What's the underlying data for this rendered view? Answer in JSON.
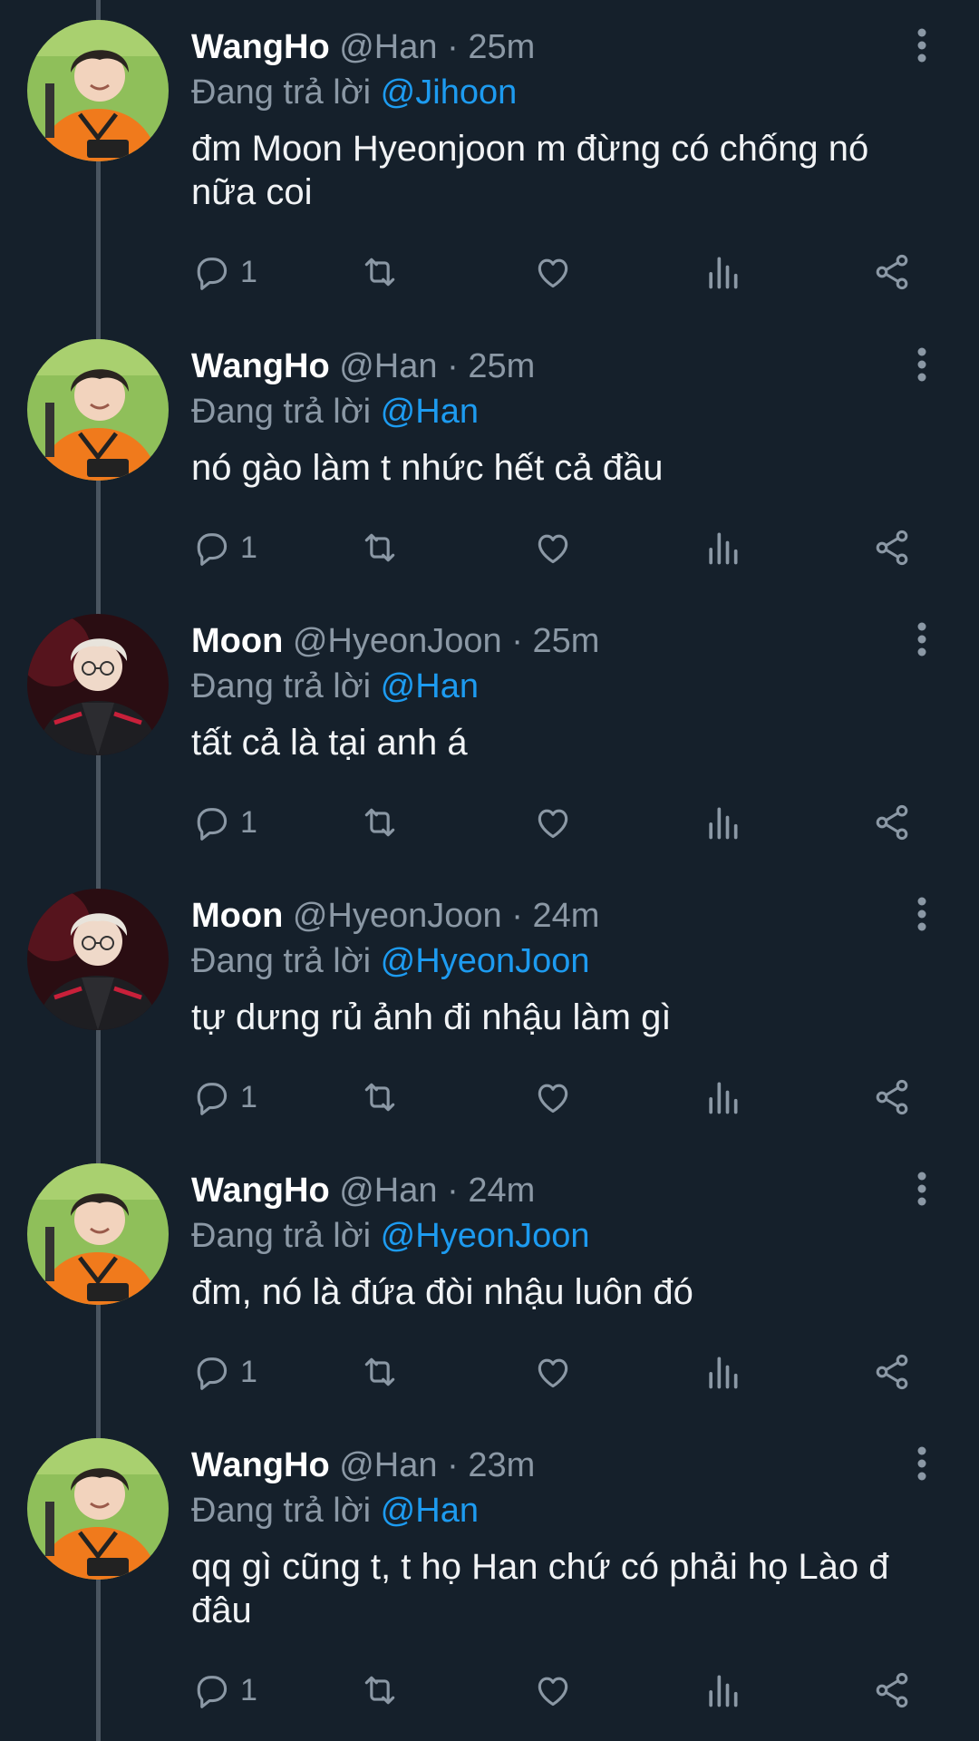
{
  "reply_prefix": "Đang trả lời",
  "colors": {
    "background": "#15202b",
    "mention": "#1d9bf0",
    "secondary_text": "#8b98a5",
    "thread_line": "#4a5560"
  },
  "icons": [
    "reply-icon",
    "retweet-icon",
    "like-icon",
    "views-icon",
    "share-icon",
    "more-options-icon"
  ],
  "tweets": [
    {
      "name": "WangHo",
      "handle": "@Han",
      "time": "25m",
      "reply_to": "@Jihoon",
      "text": "đm Moon Hyeonjoon m đừng có chống nó nữa coi",
      "reply_count": "1",
      "avatar": "avatar-wangho"
    },
    {
      "name": "WangHo",
      "handle": "@Han",
      "time": "25m",
      "reply_to": "@Han",
      "text": "nó gào làm t nhức hết cả đầu",
      "reply_count": "1",
      "avatar": "avatar-wangho"
    },
    {
      "name": "Moon",
      "handle": "@HyeonJoon",
      "time": "25m",
      "reply_to": "@Han",
      "text": "tất cả là tại anh á",
      "reply_count": "1",
      "avatar": "avatar-moon"
    },
    {
      "name": "Moon",
      "handle": "@HyeonJoon",
      "time": "24m",
      "reply_to": "@HyeonJoon",
      "text": "tự dưng rủ ảnh đi nhậu làm gì",
      "reply_count": "1",
      "avatar": "avatar-moon"
    },
    {
      "name": "WangHo",
      "handle": "@Han",
      "time": "24m",
      "reply_to": "@HyeonJoon",
      "text": "đm, nó là đứa đòi nhậu luôn đó",
      "reply_count": "1",
      "avatar": "avatar-wangho"
    },
    {
      "name": "WangHo",
      "handle": "@Han",
      "time": "23m",
      "reply_to": "@Han",
      "text": "qq gì cũng t, t họ Han chứ có phải họ Lào đ đâu",
      "reply_count": "1",
      "avatar": "avatar-wangho"
    }
  ]
}
